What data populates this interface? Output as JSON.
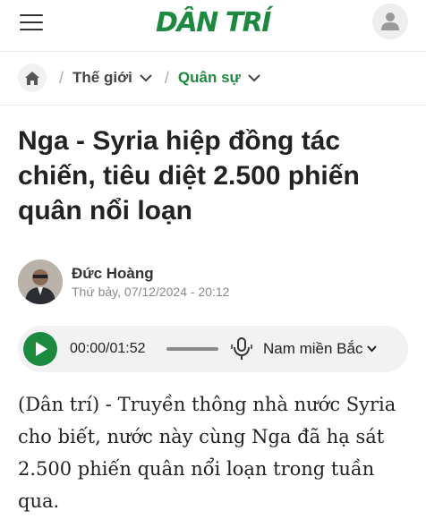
{
  "header": {
    "logo": "DÂN TRÍ",
    "menu_icon": "hamburger-menu-icon",
    "account_icon": "user-icon"
  },
  "breadcrumb": {
    "home_icon": "home-icon",
    "items": [
      {
        "label": "Thế giới"
      },
      {
        "label": "Quân sự"
      }
    ]
  },
  "article": {
    "title": "Nga - Syria hiệp đồng tác chiến, tiêu diệt 2.500 phiến quân nổi loạn",
    "author": "Đức Hoàng",
    "timestamp": "Thứ bảy, 07/12/2024 - 20:12",
    "body": "(Dân trí) - Truyền thông nhà nước Syria cho biết, nước này cùng Nga đã hạ sát 2.500 phiến quân nổi loạn trong tuần qua."
  },
  "audio_player": {
    "time": "00:00/01:52",
    "progress": 0,
    "voice": "Nam miền Bắc",
    "play_icon": "play-icon",
    "mic_icon": "microphone-icon"
  },
  "colors": {
    "brand": "#1b8a3e",
    "text": "#222222",
    "muted": "#8a8a8a"
  }
}
